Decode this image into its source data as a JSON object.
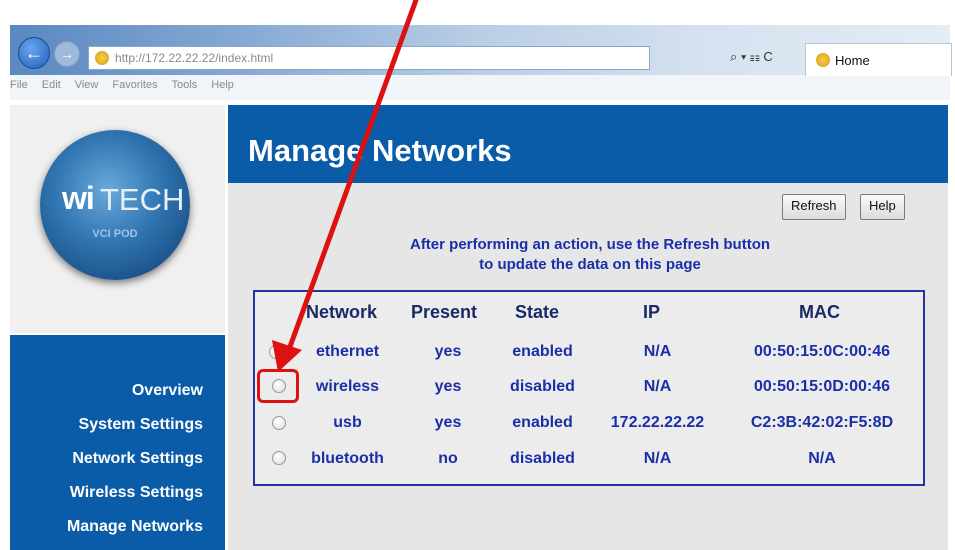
{
  "browser": {
    "url_host": "http://172.22.22.22",
    "url_path": "/index.html",
    "tab_title": "Home",
    "addr_tools": "⌕ ▾ ☷ C",
    "menu": [
      "File",
      "Edit",
      "View",
      "Favorites",
      "Tools",
      "Help"
    ]
  },
  "logo": {
    "wi": "wi",
    "tech": "TECH",
    "sub": "VCI POD"
  },
  "sidebar": {
    "items": [
      "Overview",
      "System Settings",
      "Network Settings",
      "Wireless Settings",
      "Manage Networks"
    ]
  },
  "page": {
    "title": "Manage Networks",
    "refresh_label": "Refresh",
    "help_label": "Help",
    "instruction_line1": "After performing an action, use the Refresh button",
    "instruction_line2": "to update the data on this page"
  },
  "table": {
    "headers": [
      "Network",
      "Present",
      "State",
      "IP",
      "MAC"
    ],
    "rows": [
      [
        "ethernet",
        "yes",
        "enabled",
        "N/A",
        "00:50:15:0C:00:46"
      ],
      [
        "wireless",
        "yes",
        "disabled",
        "N/A",
        "00:50:15:0D:00:46"
      ],
      [
        "usb",
        "yes",
        "enabled",
        "172.22.22.22",
        "C2:3B:42:02:F5:8D"
      ],
      [
        "bluetooth",
        "no",
        "disabled",
        "N/A",
        "N/A"
      ]
    ]
  },
  "annotation_color": "#dd1111"
}
